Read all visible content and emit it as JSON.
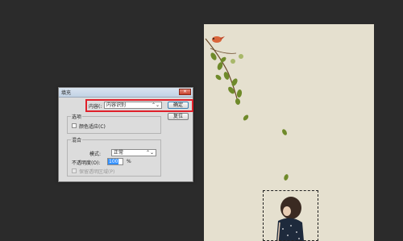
{
  "dialog": {
    "title": "填充",
    "close_icon": "×",
    "content_label": "内容(:",
    "content_value": "内容识别",
    "ok_label": "确定",
    "reset_label": "复位",
    "options_legend": "选项",
    "color_adaptation_label": "颜色适应(C)",
    "blending_legend": "混合",
    "mode_label": "模式:",
    "mode_value": "正常",
    "opacity_label": "不透明度(O):",
    "opacity_value": "100",
    "opacity_unit": "%",
    "preserve_transparency_label": "保留透明区域(P)",
    "dropdown_icon": "⌃⌄"
  },
  "colors": {
    "workspace": "#2b2b2b",
    "canvas": "#e5e0cf",
    "highlight": "#e0202a",
    "leaf": "#6f8a2a",
    "bird": "#d9643a"
  }
}
